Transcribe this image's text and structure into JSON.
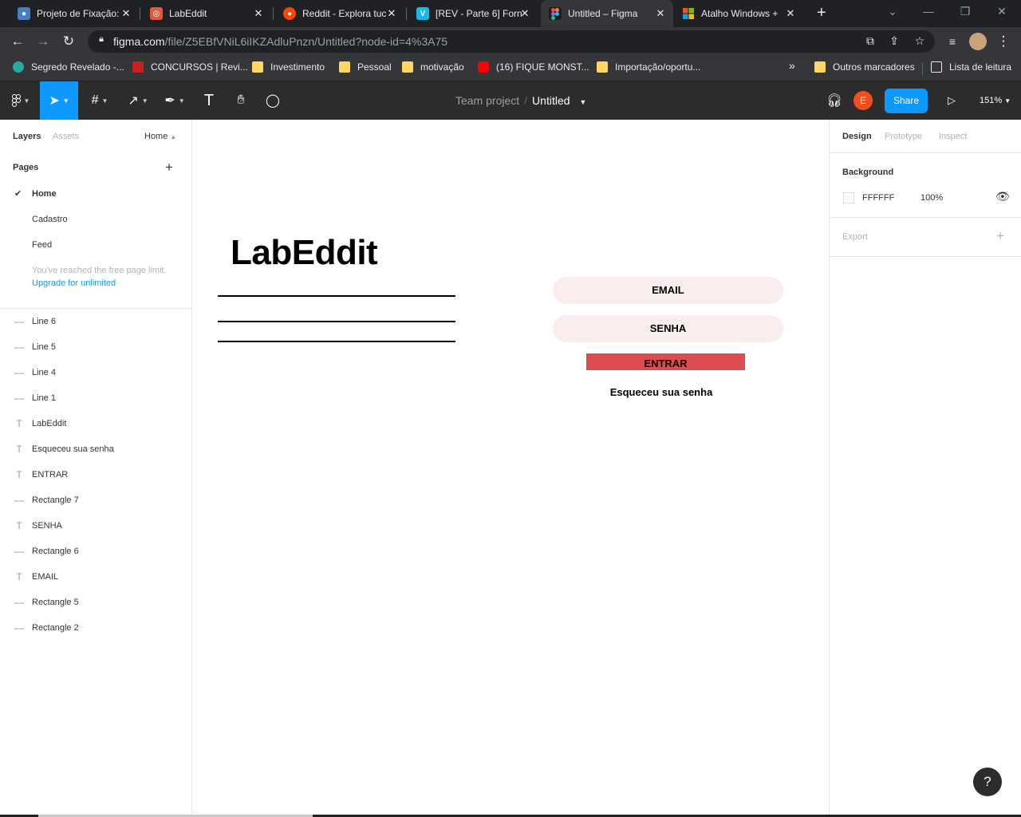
{
  "browser": {
    "tabs": [
      {
        "title": "Projeto de Fixação:",
        "favicon": "github-icon",
        "color": "#4a7fbf"
      },
      {
        "title": "LabEddit",
        "favicon": "labeddit-icon",
        "color": "#e05a3a"
      },
      {
        "title": "Reddit - Explora tuc",
        "favicon": "reddit-icon",
        "color": "#ff4500"
      },
      {
        "title": "[REV - Parte 6] Forn",
        "favicon": "vimeo-icon",
        "color": "#1ab7ea"
      },
      {
        "title": "Untitled – Figma",
        "favicon": "figma-icon",
        "color": "#a259ff"
      },
      {
        "title": "Atalho Windows +",
        "favicon": "microsoft-icon",
        "color": "#f25022"
      }
    ],
    "url_host": "figma.com",
    "url_path": "/file/Z5EBfVNiL6iIKZAdluPnzn/Untitled?node-id=4%3A75",
    "bookmarks": [
      {
        "label": "Segredo Revelado -..."
      },
      {
        "label": "CONCURSOS | Revi..."
      },
      {
        "label": "Investimento"
      },
      {
        "label": "Pessoal"
      },
      {
        "label": "motivação"
      },
      {
        "label": "(16) FIQUE MONST..."
      },
      {
        "label": "Importação/oportu..."
      }
    ],
    "overflow": "»",
    "other_bookmarks": "Outros marcadores",
    "reading_list": "Lista de leitura"
  },
  "toolbar": {
    "team": "Team project",
    "separator": "/",
    "file": "Untitled",
    "avatar_letter": "E",
    "share": "Share",
    "zoom": "151%"
  },
  "left": {
    "tab_layers": "Layers",
    "tab_assets": "Assets",
    "page_switcher": "Home",
    "pages_title": "Pages",
    "pages": [
      "Home",
      "Cadastro",
      "Feed"
    ],
    "limit_text": "You've reached the free page limit.",
    "upgrade_link": "Upgrade for unlimited",
    "layers": [
      {
        "type": "line",
        "name": "Line 6"
      },
      {
        "type": "line",
        "name": "Line 5"
      },
      {
        "type": "line",
        "name": "Line 4"
      },
      {
        "type": "line",
        "name": "Line 1"
      },
      {
        "type": "text",
        "name": "LabEddit"
      },
      {
        "type": "text",
        "name": "Esqueceu sua senha"
      },
      {
        "type": "text",
        "name": "ENTRAR"
      },
      {
        "type": "rect",
        "name": "Rectangle 7"
      },
      {
        "type": "text",
        "name": "SENHA"
      },
      {
        "type": "rect",
        "name": "Rectangle 6"
      },
      {
        "type": "text",
        "name": "EMAIL"
      },
      {
        "type": "rect",
        "name": "Rectangle 5"
      },
      {
        "type": "rect",
        "name": "Rectangle 2"
      }
    ]
  },
  "canvas": {
    "logo": "LabEddit",
    "email": "EMAIL",
    "senha": "SENHA",
    "entrar": "ENTRAR",
    "forgot": "Esqueceu sua senha"
  },
  "right": {
    "tab_design": "Design",
    "tab_prototype": "Prototype",
    "tab_inspect": "Inspect",
    "background_title": "Background",
    "bg_hex": "FFFFFF",
    "bg_opacity": "100%",
    "export_title": "Export",
    "help": "?"
  },
  "colors": {
    "accent": "#0d99ff",
    "entrar_button": "#dd4c4f",
    "input_pill": "#f9eded"
  }
}
